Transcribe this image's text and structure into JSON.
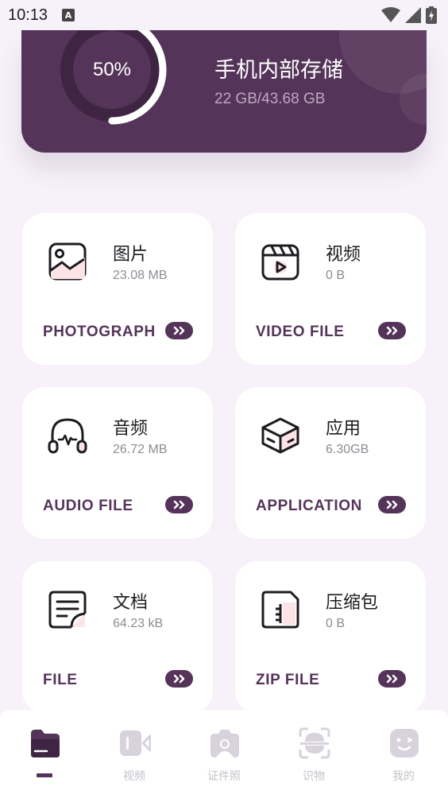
{
  "status_bar": {
    "time": "10:13",
    "notification_icon": "a-icon",
    "icons": [
      "wifi-icon",
      "signal-icon",
      "battery-charging-icon"
    ]
  },
  "storage": {
    "percent": "50%",
    "percent_value": 0.5,
    "title": "手机内部存储",
    "usage": "22 GB/43.68 GB"
  },
  "categories": [
    {
      "title": "图片",
      "size": "23.08 MB",
      "label": "PHOTOGRAPH",
      "icon": "image-icon"
    },
    {
      "title": "视频",
      "size": "0 B",
      "label": "VIDEO FILE",
      "icon": "video-icon"
    },
    {
      "title": "音频",
      "size": "26.72 MB",
      "label": "AUDIO FILE",
      "icon": "headphones-icon"
    },
    {
      "title": "应用",
      "size": "6.30GB",
      "label": "APPLICATION",
      "icon": "box-icon"
    },
    {
      "title": "文档",
      "size": "64.23 kB",
      "label": "FILE",
      "icon": "document-icon"
    },
    {
      "title": "压缩包",
      "size": "0 B",
      "label": "ZIP FILE",
      "icon": "zip-icon"
    }
  ],
  "bottom_nav": [
    {
      "label": "",
      "icon": "folder-icon",
      "active": true
    },
    {
      "label": "视频",
      "icon": "video-camera-icon",
      "active": false
    },
    {
      "label": "证件照",
      "icon": "camera-icon",
      "active": false
    },
    {
      "label": "识物",
      "icon": "scan-icon",
      "active": false
    },
    {
      "label": "我的",
      "icon": "face-icon",
      "active": false
    }
  ],
  "colors": {
    "primary": "#553459",
    "background": "#f7f2f9",
    "accent_soft": "#fbe3e6",
    "nav_inactive": "#c6c0ca"
  }
}
